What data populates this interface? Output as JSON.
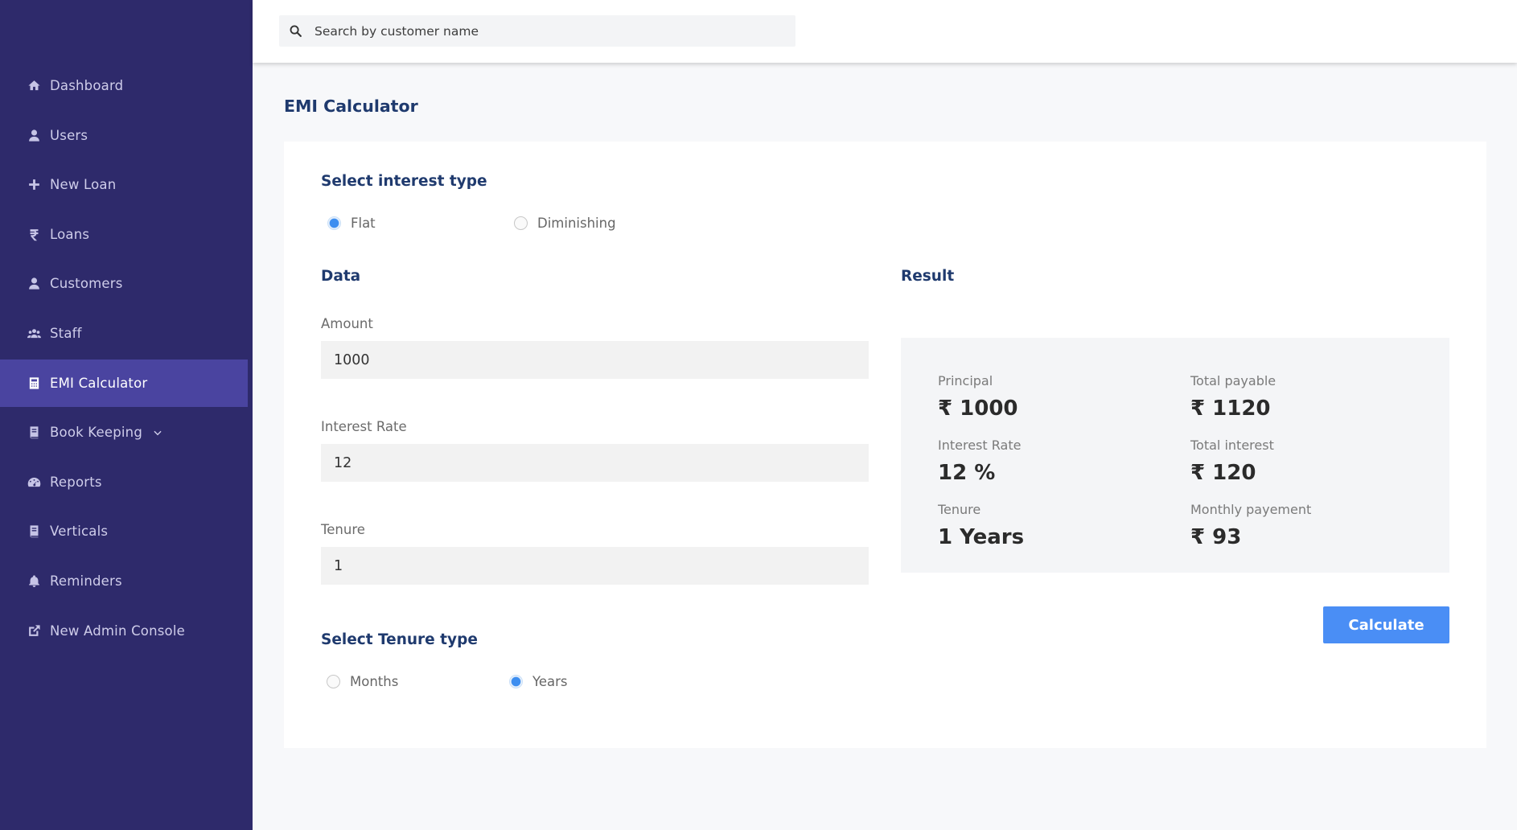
{
  "search": {
    "placeholder": "Search by customer name"
  },
  "sidebar": {
    "items": [
      {
        "label": "Dashboard",
        "icon": "home-icon"
      },
      {
        "label": "Users",
        "icon": "user-icon"
      },
      {
        "label": "New Loan",
        "icon": "plus-icon"
      },
      {
        "label": "Loans",
        "icon": "rupee-icon"
      },
      {
        "label": "Customers",
        "icon": "user-icon"
      },
      {
        "label": "Staff",
        "icon": "users-group-icon"
      },
      {
        "label": "EMI Calculator",
        "icon": "calculator-icon",
        "active": true
      },
      {
        "label": "Book Keeping",
        "icon": "book-icon",
        "has_submenu": true
      },
      {
        "label": "Reports",
        "icon": "gauge-icon"
      },
      {
        "label": "Verticals",
        "icon": "book-icon"
      },
      {
        "label": "Reminders",
        "icon": "bell-icon"
      },
      {
        "label": "New Admin Console",
        "icon": "external-link-icon"
      }
    ]
  },
  "page": {
    "title": "EMI Calculator"
  },
  "interest_type": {
    "title": "Select interest type",
    "options": [
      {
        "label": "Flat",
        "checked": true
      },
      {
        "label": "Diminishing",
        "checked": false
      }
    ]
  },
  "data_section": {
    "title": "Data",
    "amount": {
      "label": "Amount",
      "value": "1000"
    },
    "interest_rate": {
      "label": "Interest Rate",
      "value": "12"
    },
    "tenure": {
      "label": "Tenure",
      "value": "1"
    }
  },
  "tenure_type": {
    "title": "Select Tenure type",
    "options": [
      {
        "label": "Months",
        "checked": false
      },
      {
        "label": "Years",
        "checked": true
      }
    ]
  },
  "result": {
    "title": "Result",
    "principal": {
      "label": "Principal",
      "value": "₹ 1000"
    },
    "total_payable": {
      "label": "Total payable",
      "value": "₹ 1120"
    },
    "interest_rate": {
      "label": "Interest Rate",
      "value": "12 %"
    },
    "total_interest": {
      "label": "Total interest",
      "value": "₹ 120"
    },
    "tenure": {
      "label": "Tenure",
      "value": "1 Years"
    },
    "monthly_payment": {
      "label": "Monthly payement",
      "value": "₹ 93"
    }
  },
  "actions": {
    "calculate_label": "Calculate"
  },
  "colors": {
    "sidebar_bg": "#2e2a6b",
    "sidebar_active": "#4a44a0",
    "accent": "#4a8ef5",
    "heading": "#1f3a6e"
  }
}
